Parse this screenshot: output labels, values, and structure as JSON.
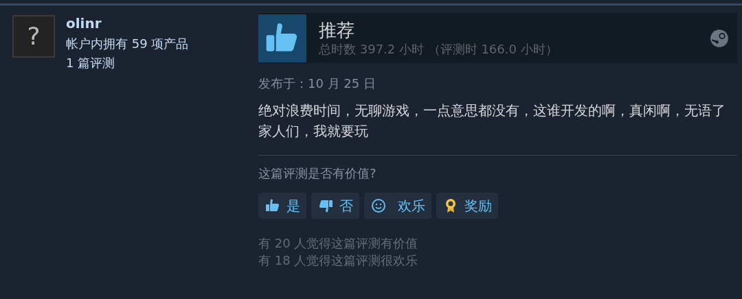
{
  "reviewer": {
    "avatar_glyph": "?",
    "name": "olinr",
    "products": "帐户内拥有 59 项产品",
    "reviews": "1 篇评测"
  },
  "review": {
    "verdict": "推荐",
    "hours": "总时数 397.2 小时 （评测时 166.0 小时）",
    "posted": "发布于：10 月 25 日",
    "text": "绝对浪费时间，无聊游戏，一点意思都没有，这谁开发的啊，真闲啊，无语了家人们，我就要玩"
  },
  "feedback": {
    "question": "这篇评测是否有价值?",
    "buttons": [
      {
        "kind": "yes",
        "label": "是"
      },
      {
        "kind": "no",
        "label": "否"
      },
      {
        "kind": "funny",
        "label": "欢乐"
      },
      {
        "kind": "award",
        "label": "奖励"
      }
    ],
    "stats": [
      "有 20 人觉得这篇评测有价值",
      "有 18 人觉得这篇评测很欢乐"
    ]
  }
}
